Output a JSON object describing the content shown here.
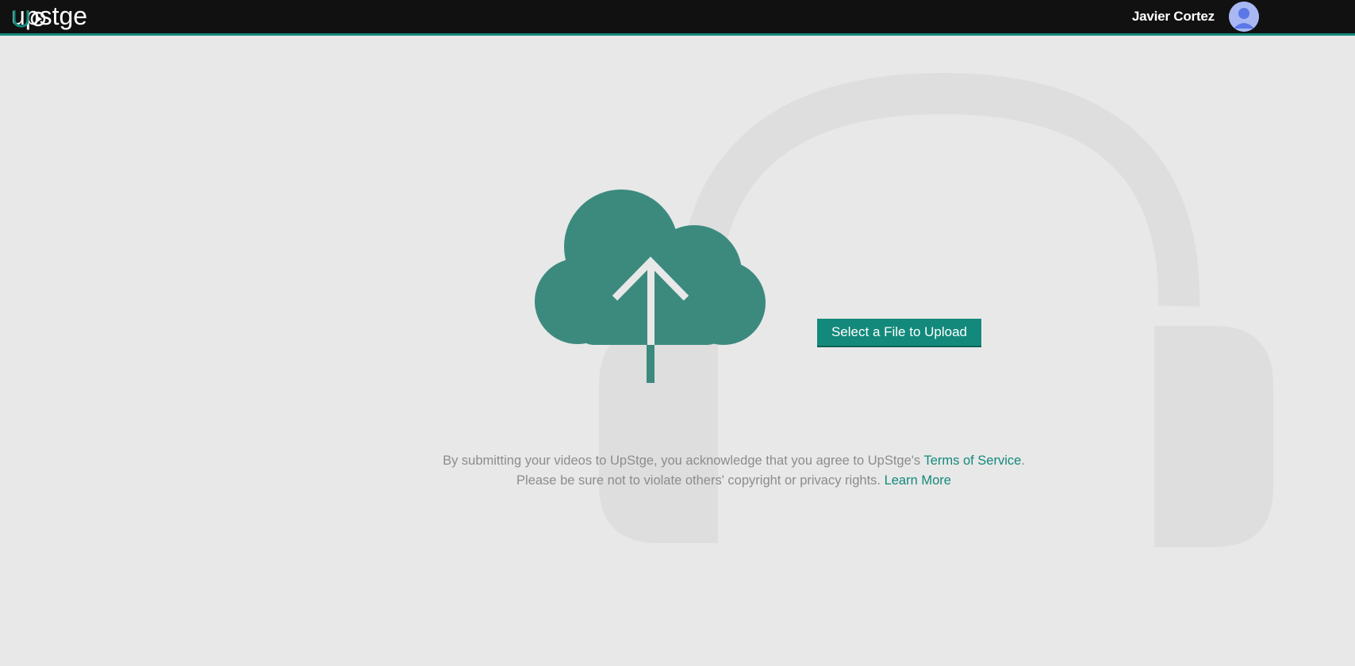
{
  "header": {
    "logo_text": "upstge",
    "user_name": "Javier Cortez"
  },
  "upload": {
    "button_label": "Select a File to Upload"
  },
  "disclaimer": {
    "line1_prefix": "By submitting your videos to UpStge, you acknowledge that you agree to UpStge's ",
    "terms_link": "Terms of Service",
    "line1_suffix": ".",
    "line2_prefix": "Please be sure not to violate others' copyright or privacy rights. ",
    "learn_more_link": "Learn More"
  },
  "colors": {
    "accent": "#13897b",
    "cloud": "#3c8a7e",
    "topbar": "#111111",
    "background": "#e8e8e8"
  }
}
